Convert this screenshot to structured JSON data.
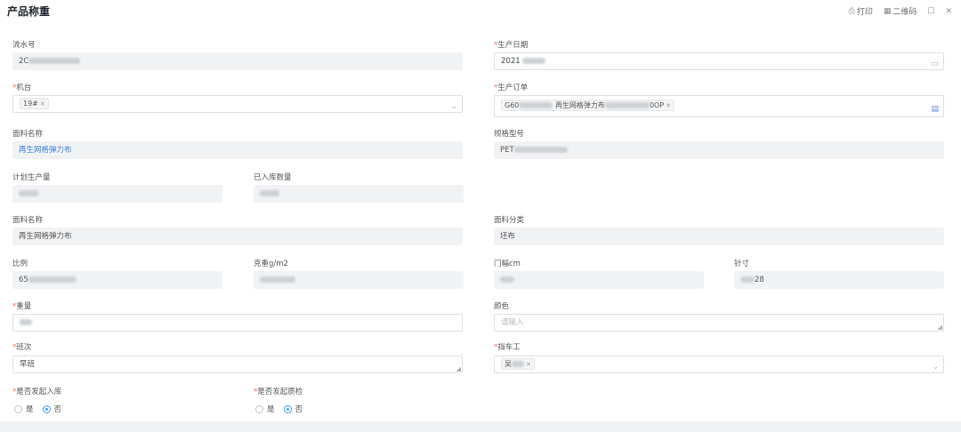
{
  "header": {
    "title": "产品称重",
    "print_label": "打印",
    "qrcode_label": "二维码",
    "icons": [
      "printer-icon",
      "qrcode-icon",
      "maximize-icon",
      "close-icon"
    ]
  },
  "form": {
    "serial_no": {
      "label": "流水号",
      "value_prefix": "2C"
    },
    "production_date": {
      "label": "生产日期",
      "value_prefix": "2021"
    },
    "machine": {
      "label": "机台",
      "tag": "19#"
    },
    "production_order": {
      "label": "生产订单",
      "tag_prefix": "G60",
      "tag_mid": "再生网格弹力布",
      "tag_suffix": "0OP"
    },
    "fabric_name_top": {
      "label": "面料名称",
      "value": "再生网格弹力布"
    },
    "spec_model": {
      "label": "规格型号",
      "value_prefix": "PET"
    },
    "planned_qty": {
      "label": "计划生产量"
    },
    "stocked_qty": {
      "label": "已入库数量"
    },
    "fabric_name": {
      "label": "面料名称",
      "value": "再生网格弹力布"
    },
    "fabric_category": {
      "label": "面料分类",
      "value": "坯布"
    },
    "ratio": {
      "label": "比例",
      "value_prefix": "65"
    },
    "weight_gsm": {
      "label": "克重g/m2"
    },
    "width_cm": {
      "label": "门幅cm"
    },
    "gauge": {
      "label": "针寸",
      "value_suffix": "28"
    },
    "weight": {
      "label": "重量"
    },
    "color": {
      "label": "颜色",
      "placeholder": "请输入"
    },
    "shift": {
      "label": "班次",
      "value": "早班"
    },
    "operator": {
      "label": "挡车工",
      "tag_prefix": "吴"
    },
    "start_stock_in": {
      "label": "是否发起入库",
      "options": [
        "是",
        "否"
      ],
      "selected": "否"
    },
    "start_qc": {
      "label": "是否发起质检",
      "options": [
        "是",
        "否"
      ],
      "selected": "否"
    }
  },
  "colors": {
    "accent": "#409eff",
    "required": "#f56c6c",
    "link": "#3b82d6"
  }
}
